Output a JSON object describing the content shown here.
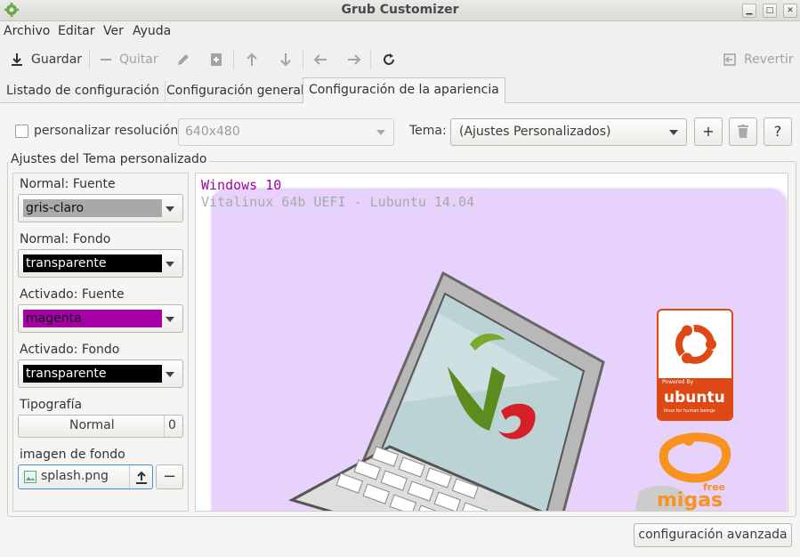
{
  "window": {
    "title": "Grub Customizer"
  },
  "menu": [
    "Archivo",
    "Editar",
    "Ver",
    "Ayuda"
  ],
  "toolbar": {
    "save_label": "Guardar",
    "remove_label": "Quitar",
    "revert_label": "Revertir"
  },
  "tabs": [
    "Listado de configuración",
    "Configuración general",
    "Configuración de la apariencia"
  ],
  "resolution": {
    "checkbox_label": "personalizar resolución",
    "value": "640x480"
  },
  "theme": {
    "label": "Tema:",
    "value": "(Ajustes Personalizados)",
    "add": "+",
    "help": "?"
  },
  "custom": {
    "title": "Ajustes del Tema personalizado",
    "normal_font_label": "Normal: Fuente",
    "normal_font_value": "gris-claro",
    "normal_bg_label": "Normal: Fondo",
    "normal_bg_value": "transparente",
    "active_font_label": "Activado: Fuente",
    "active_font_value": "magenta",
    "active_bg_label": "Activado: Fondo",
    "active_bg_value": "transparente",
    "typography_label": "Tipografía",
    "typography_value": "Normal",
    "typography_size": "0",
    "bg_image_label": "imagen de fondo",
    "bg_image_value": "splash.png",
    "remove_symbol": "−"
  },
  "preview": {
    "line1": "Windows 10",
    "line2": "Vitalinux 64b UEFI - Lubuntu 14.04",
    "ubuntu_small": "Powered By",
    "ubuntu_word": "ubuntu",
    "ubuntu_tag": "linux for human beings",
    "migas_free": "free",
    "migas_word": "migas"
  },
  "advanced_button": "configuración avanzada",
  "colors": {
    "gris_claro": "#a9a9a9",
    "transparente": "#000000",
    "magenta": "#a400a4",
    "preview_bg": "#e6d2fa",
    "ubuntu_orange": "#dd4814"
  }
}
